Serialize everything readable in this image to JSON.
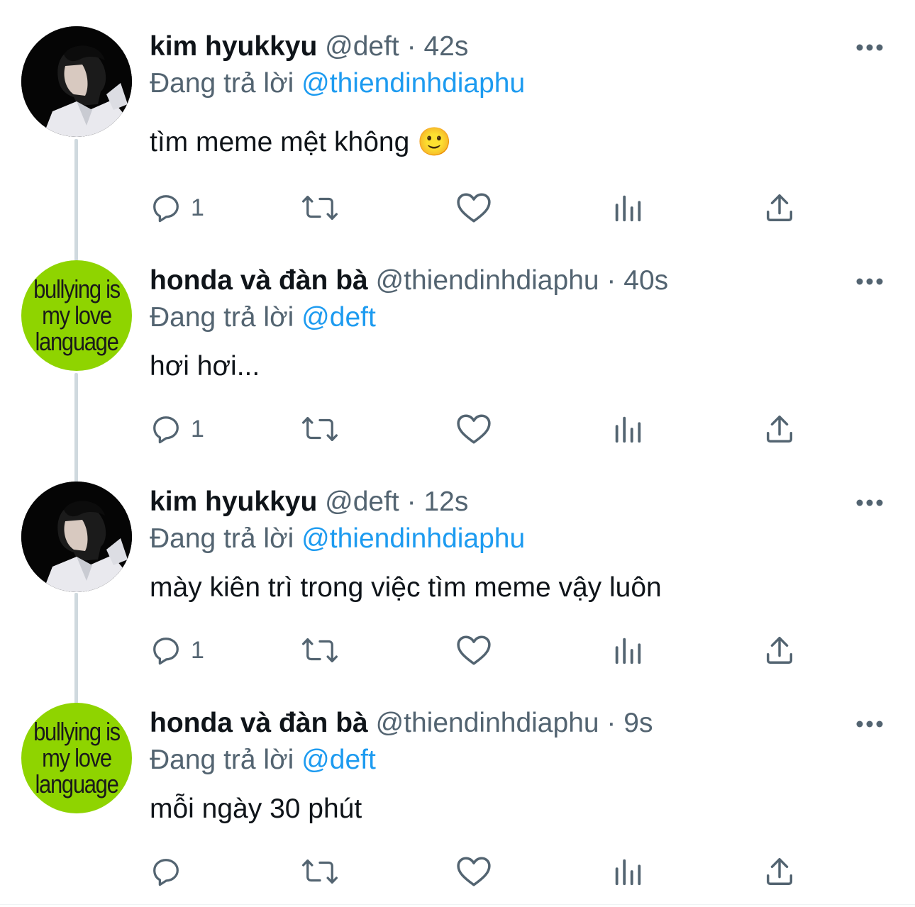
{
  "tweets": [
    {
      "name": "kim hyukkyu",
      "handle": "@deft",
      "separator": "·",
      "time": "42s",
      "replying_prefix": "Đang trả lời",
      "replying_to": "@thiendinhdiaphu",
      "text": "tìm meme mệt không 🙂",
      "reply_count": "1",
      "avatar": "photo-avatar"
    },
    {
      "name": "honda và đàn bà",
      "handle": "@thiendinhdiaphu",
      "separator": "·",
      "time": "40s",
      "replying_prefix": "Đang trả lời",
      "replying_to": "@deft",
      "text": "hơi hơi...",
      "reply_count": "1",
      "avatar": "green-meme-avatar",
      "avatar_text": [
        "bullying is",
        "my love",
        "language"
      ]
    },
    {
      "name": "kim hyukkyu",
      "handle": "@deft",
      "separator": "·",
      "time": "12s",
      "replying_prefix": "Đang trả lời",
      "replying_to": "@thiendinhdiaphu",
      "text": "mày kiên trì trong việc tìm meme vậy luôn",
      "reply_count": "1",
      "avatar": "photo-avatar"
    },
    {
      "name": "honda và đàn bà",
      "handle": "@thiendinhdiaphu",
      "separator": "·",
      "time": "9s",
      "replying_prefix": "Đang trả lời",
      "replying_to": "@deft",
      "text": "mỗi ngày 30 phút",
      "reply_count": "",
      "avatar": "green-meme-avatar",
      "avatar_text": [
        "bullying is",
        "my love",
        "language"
      ]
    }
  ],
  "icons": {
    "reply": "reply-icon",
    "retweet": "retweet-icon",
    "like": "like-icon",
    "views": "views-icon",
    "share": "share-icon",
    "more": "more-icon"
  },
  "colors": {
    "text": "#0f1419",
    "secondary": "#536471",
    "link": "#1d9bf0",
    "thread_line": "#cfd9de",
    "avatar_green": "#8fd400"
  }
}
